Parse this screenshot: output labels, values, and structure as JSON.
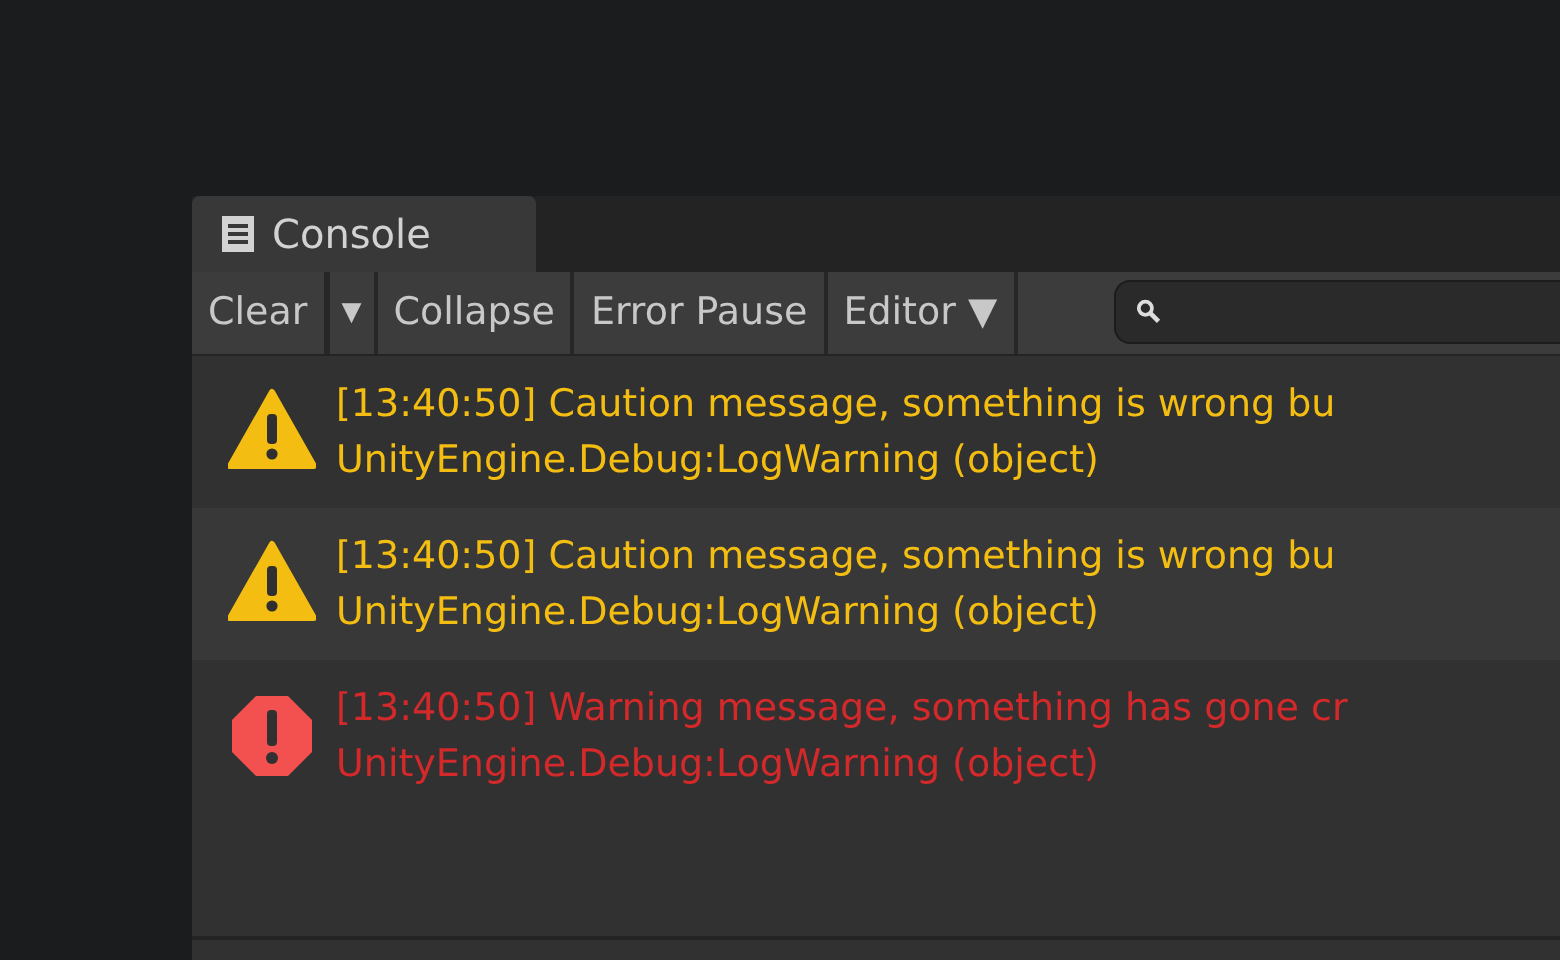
{
  "tabs": [
    {
      "label": "Console",
      "selected": true
    }
  ],
  "toolbar": {
    "buttons": [
      {
        "label": "Clear",
        "kind": "button"
      },
      {
        "label": "▼",
        "kind": "dropdown"
      },
      {
        "label": "Collapse",
        "kind": "toggle"
      },
      {
        "label": "Error Pause",
        "kind": "toggle"
      },
      {
        "label": "Editor ▼",
        "kind": "menu"
      }
    ]
  },
  "log": [
    {
      "kind": "warning",
      "message": "[13:40:50] Caution message, something is wrong bu",
      "trace": "UnityEngine.Debug:LogWarning (object)"
    },
    {
      "kind": "warning",
      "message": "[13:40:50] Caution message, something is wrong bu",
      "trace": "UnityEngine.Debug:LogWarning (object)"
    },
    {
      "kind": "error",
      "message": "[13:40:50] Warning message, something has gone cr",
      "trace": "UnityEngine.Debug:LogWarning (object)"
    }
  ]
}
